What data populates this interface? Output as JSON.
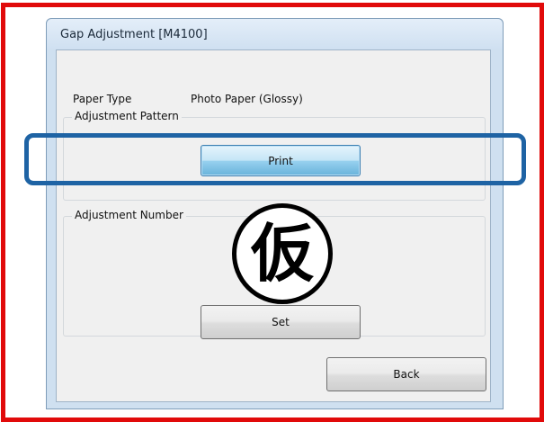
{
  "window": {
    "title": "Gap Adjustment [M4100]"
  },
  "paper": {
    "label": "Paper Type",
    "value": "Photo Paper (Glossy)"
  },
  "adjustment_pattern": {
    "legend": "Adjustment Pattern",
    "print_label": "Print"
  },
  "adjustment_number": {
    "legend": "Adjustment Number",
    "set_label": "Set"
  },
  "footer": {
    "back_label": "Back"
  },
  "overlay": {
    "stamp_text": "仮"
  },
  "colors": {
    "frame_border": "#e10a0a",
    "highlight": "#1e63a4",
    "print_button": "#98d1ef"
  }
}
